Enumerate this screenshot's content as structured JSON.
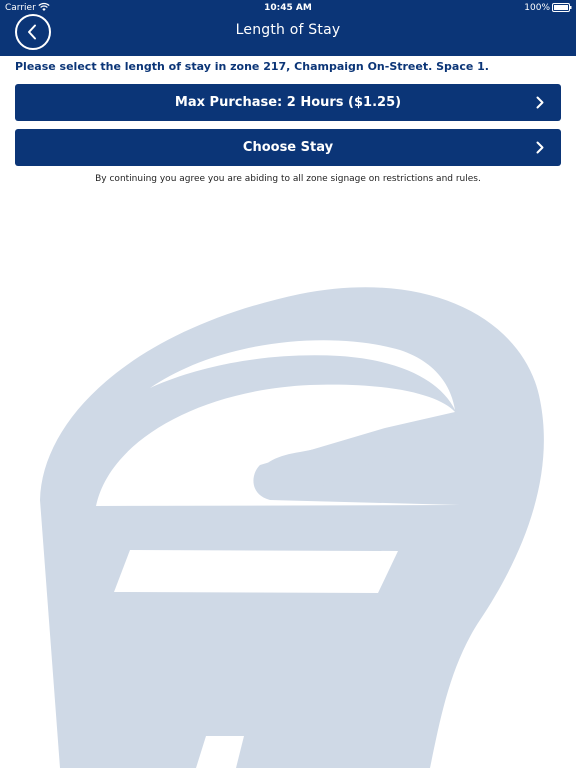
{
  "status_bar": {
    "carrier": "Carrier",
    "time": "10:45 AM",
    "battery": "100%"
  },
  "nav": {
    "title": "Length of Stay"
  },
  "instruction": "Please select the length of stay in zone 217, Champaign On-Street. Space 1.",
  "buttons": {
    "max_purchase": "Max Purchase: 2 Hours ($1.25)",
    "choose_stay": "Choose Stay"
  },
  "disclaimer": "By continuing you agree you are abiding to all zone signage on restrictions and rules.",
  "colors": {
    "primary": "#0b3577",
    "watermark": "#cfd9e6"
  },
  "icons": {
    "back": "chevron-left-icon",
    "chevron": "chevron-right-icon",
    "watermark": "parking-meter-icon"
  }
}
